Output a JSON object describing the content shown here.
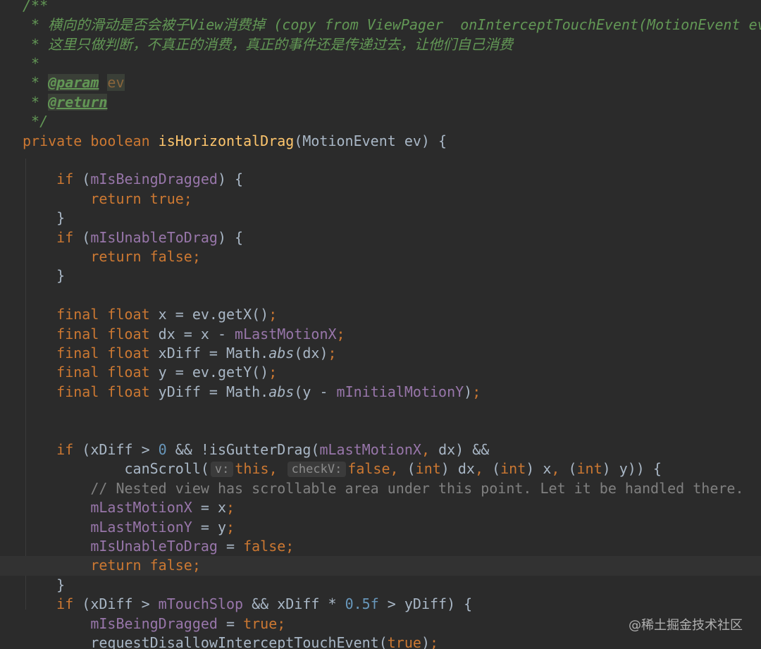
{
  "editor": {
    "language": "java",
    "theme_colors": {
      "background": "#2b2b2b",
      "keyword": "#cc7832",
      "field": "#9876aa",
      "method": "#ffc66d",
      "number": "#6897bb",
      "comment": "#808080",
      "doc_comment": "#629755",
      "text": "#a9b7c6"
    },
    "lines": [
      {
        "tokens": [
          {
            "t": "/**",
            "c": "dtxt"
          }
        ]
      },
      {
        "tokens": [
          {
            "t": " * 横向的滑动是否会被子View消费掉 (copy from ViewPager  onInterceptTouchEvent(MotionEvent ev))",
            "c": "dtxt"
          }
        ]
      },
      {
        "tokens": [
          {
            "t": " * 这里只做判断，不真正的消费，真正的事件还是传递过去，让他们自己消费",
            "c": "dtxt"
          }
        ]
      },
      {
        "tokens": [
          {
            "t": " *",
            "c": "dtxt"
          }
        ]
      },
      {
        "tokens": [
          {
            "t": " * ",
            "c": "dtxt"
          },
          {
            "t": "@param",
            "c": "dtag"
          },
          {
            "t": " ",
            "c": "dtxt"
          },
          {
            "t": "ev",
            "c": "dparam"
          }
        ]
      },
      {
        "tokens": [
          {
            "t": " * ",
            "c": "dtxt"
          },
          {
            "t": "@return",
            "c": "dtag"
          }
        ]
      },
      {
        "tokens": [
          {
            "t": " */",
            "c": "dtxt"
          }
        ]
      },
      {
        "tokens": [
          {
            "t": "private boolean ",
            "c": "kw"
          },
          {
            "t": "isHorizontalDrag",
            "c": "fn"
          },
          {
            "t": "(MotionEvent ev) {",
            "c": ""
          }
        ]
      },
      {
        "tokens": []
      },
      {
        "tokens": [
          {
            "t": "    if ",
            "c": "kw"
          },
          {
            "t": "(",
            "c": ""
          },
          {
            "t": "mIsBeingDragged",
            "c": "fld"
          },
          {
            "t": ") {",
            "c": ""
          }
        ]
      },
      {
        "tokens": [
          {
            "t": "        return true",
            "c": "kw"
          },
          {
            "t": ";",
            "c": "kw"
          }
        ]
      },
      {
        "tokens": [
          {
            "t": "    }",
            "c": ""
          }
        ]
      },
      {
        "tokens": [
          {
            "t": "    if ",
            "c": "kw"
          },
          {
            "t": "(",
            "c": ""
          },
          {
            "t": "mIsUnableToDrag",
            "c": "fld"
          },
          {
            "t": ") {",
            "c": ""
          }
        ]
      },
      {
        "tokens": [
          {
            "t": "        return false",
            "c": "kw"
          },
          {
            "t": ";",
            "c": "kw"
          }
        ]
      },
      {
        "tokens": [
          {
            "t": "    }",
            "c": ""
          }
        ]
      },
      {
        "tokens": []
      },
      {
        "tokens": [
          {
            "t": "    final float ",
            "c": "kw"
          },
          {
            "t": "x = ev.getX()",
            "c": ""
          },
          {
            "t": ";",
            "c": "kw"
          }
        ]
      },
      {
        "tokens": [
          {
            "t": "    final float ",
            "c": "kw"
          },
          {
            "t": "dx = x - ",
            "c": ""
          },
          {
            "t": "mLastMotionX",
            "c": "fld"
          },
          {
            "t": ";",
            "c": "kw"
          }
        ]
      },
      {
        "tokens": [
          {
            "t": "    final float ",
            "c": "kw"
          },
          {
            "t": "xDiff = Math.",
            "c": ""
          },
          {
            "t": "abs",
            "c": "ital"
          },
          {
            "t": "(dx)",
            "c": ""
          },
          {
            "t": ";",
            "c": "kw"
          }
        ]
      },
      {
        "tokens": [
          {
            "t": "    final float ",
            "c": "kw"
          },
          {
            "t": "y = ev.getY()",
            "c": ""
          },
          {
            "t": ";",
            "c": "kw"
          }
        ]
      },
      {
        "tokens": [
          {
            "t": "    final float ",
            "c": "kw"
          },
          {
            "t": "yDiff = Math.",
            "c": ""
          },
          {
            "t": "abs",
            "c": "ital"
          },
          {
            "t": "(y - ",
            "c": ""
          },
          {
            "t": "mInitialMotionY",
            "c": "fld"
          },
          {
            "t": ")",
            "c": ""
          },
          {
            "t": ";",
            "c": "kw"
          }
        ]
      },
      {
        "tokens": []
      },
      {
        "tokens": []
      },
      {
        "tokens": [
          {
            "t": "    if ",
            "c": "kw"
          },
          {
            "t": "(xDiff > ",
            "c": ""
          },
          {
            "t": "0",
            "c": "num"
          },
          {
            "t": " && !isGutterDrag(",
            "c": ""
          },
          {
            "t": "mLastMotionX",
            "c": "fld"
          },
          {
            "t": ", ",
            "c": "kw"
          },
          {
            "t": "dx) &&",
            "c": ""
          }
        ]
      },
      {
        "tokens": [
          {
            "t": "            canScroll(",
            "c": ""
          },
          {
            "t": "v:",
            "c": "hint"
          },
          {
            "t": "this",
            "c": "kw"
          },
          {
            "t": ", ",
            "c": "kw"
          },
          {
            "t": "checkV:",
            "c": "hint"
          },
          {
            "t": "false",
            "c": "kw"
          },
          {
            "t": ", ",
            "c": "kw"
          },
          {
            "t": "(",
            "c": ""
          },
          {
            "t": "int",
            "c": "kw"
          },
          {
            "t": ") dx",
            "c": ""
          },
          {
            "t": ", ",
            "c": "kw"
          },
          {
            "t": "(",
            "c": ""
          },
          {
            "t": "int",
            "c": "kw"
          },
          {
            "t": ") x",
            "c": ""
          },
          {
            "t": ", ",
            "c": "kw"
          },
          {
            "t": "(",
            "c": ""
          },
          {
            "t": "int",
            "c": "kw"
          },
          {
            "t": ") y)) {",
            "c": ""
          }
        ]
      },
      {
        "tokens": [
          {
            "t": "        // Nested view has scrollable area under this point. Let it be handled there.",
            "c": "lcm"
          }
        ]
      },
      {
        "tokens": [
          {
            "t": "        ",
            "c": ""
          },
          {
            "t": "mLastMotionX",
            "c": "fld"
          },
          {
            "t": " = x",
            "c": ""
          },
          {
            "t": ";",
            "c": "kw"
          }
        ]
      },
      {
        "tokens": [
          {
            "t": "        ",
            "c": ""
          },
          {
            "t": "mLastMotionY",
            "c": "fld"
          },
          {
            "t": " = y",
            "c": ""
          },
          {
            "t": ";",
            "c": "kw"
          }
        ]
      },
      {
        "tokens": [
          {
            "t": "        ",
            "c": ""
          },
          {
            "t": "mIsUnableToDrag",
            "c": "fld"
          },
          {
            "t": " = ",
            "c": ""
          },
          {
            "t": "false;",
            "c": "kw"
          }
        ]
      },
      {
        "tokens": [
          {
            "t": "        return false",
            "c": "kw"
          },
          {
            "t": ";",
            "c": "kw"
          }
        ],
        "current": true
      },
      {
        "tokens": [
          {
            "t": "    }",
            "c": ""
          }
        ]
      },
      {
        "tokens": [
          {
            "t": "    if ",
            "c": "kw"
          },
          {
            "t": "(xDiff > ",
            "c": ""
          },
          {
            "t": "mTouchSlop",
            "c": "fld"
          },
          {
            "t": " && xDiff * ",
            "c": ""
          },
          {
            "t": "0.5f",
            "c": "num"
          },
          {
            "t": " > yDiff) {",
            "c": ""
          }
        ]
      },
      {
        "tokens": [
          {
            "t": "        ",
            "c": ""
          },
          {
            "t": "mIsBeingDragged",
            "c": "fld"
          },
          {
            "t": " = ",
            "c": ""
          },
          {
            "t": "true;",
            "c": "kw"
          }
        ]
      },
      {
        "tokens": [
          {
            "t": "        requestDisallowInterceptTouchEvent(",
            "c": ""
          },
          {
            "t": "true",
            "c": "kw"
          },
          {
            "t": ")",
            "c": ""
          },
          {
            "t": ";",
            "c": "kw"
          }
        ]
      }
    ]
  },
  "watermark": {
    "text": "@稀土掘金技术社区"
  }
}
